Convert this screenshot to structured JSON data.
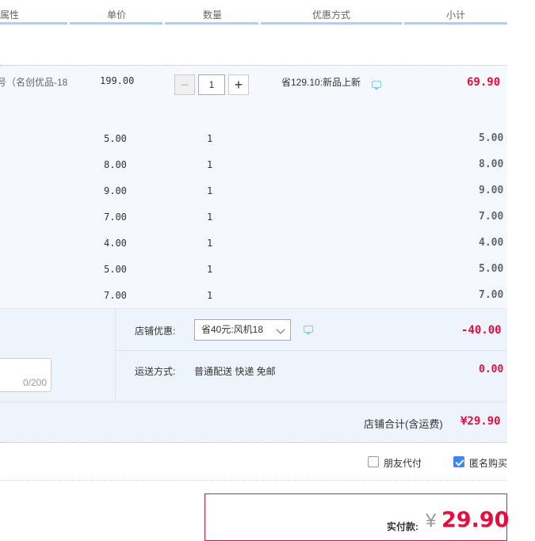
{
  "header": {
    "columns": [
      "属性",
      "单价",
      "数量",
      "优惠方式",
      "小计"
    ]
  },
  "main_item": {
    "attr_text": "（名创优品-18",
    "attr_prefix": "号",
    "price": "199.00",
    "qty": "1",
    "minus": "−",
    "plus": "+",
    "discount_text": "省129.10:新品上新",
    "subtotal": "69.90"
  },
  "sub_items": [
    {
      "price": "5.00",
      "qty": "1",
      "subtotal": "5.00"
    },
    {
      "price": "8.00",
      "qty": "1",
      "subtotal": "8.00"
    },
    {
      "price": "9.00",
      "qty": "1",
      "subtotal": "9.00"
    },
    {
      "price": "7.00",
      "qty": "1",
      "subtotal": "7.00"
    },
    {
      "price": "4.00",
      "qty": "1",
      "subtotal": "4.00"
    },
    {
      "price": "5.00",
      "qty": "1",
      "subtotal": "5.00"
    },
    {
      "price": "7.00",
      "qty": "1",
      "subtotal": "7.00"
    }
  ],
  "shop": {
    "discount_label": "店铺优惠:",
    "discount_selected": "省40元:风机18",
    "discount_amount": "-40.00",
    "shipping_label": "运送方式:",
    "shipping_value": "普通配送 快递 免邮",
    "shipping_amount": "0.00",
    "message_counter": "0/200",
    "total_label": "店铺合计(含运费)",
    "total_amount": "¥29.90"
  },
  "options": {
    "friend_pay_label": "朋友代付",
    "friend_pay_checked": false,
    "anonymous_label": "匿名购买",
    "anonymous_checked": true
  },
  "payment": {
    "label": "实付款:",
    "currency": "¥",
    "amount": "29.90"
  },
  "colors": {
    "accent_red": "#ee0a3b",
    "header_line": "#b2cdf0",
    "checkbox_blue": "#3b86f5"
  }
}
